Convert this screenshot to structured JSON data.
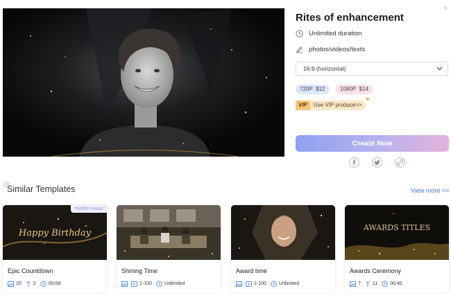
{
  "template": {
    "title": "Rites of enhancement",
    "duration": "Unlimited duration",
    "media": "photos/videos/texts",
    "ratio_selected": "16:9 (horizontal)"
  },
  "pricing": [
    {
      "label": "720P",
      "price": "$12"
    },
    {
      "label": "1080P",
      "price": "$14"
    }
  ],
  "vip": {
    "badge": "VIP",
    "text": "Use VIP produce>>"
  },
  "actions": {
    "create": "Create Now"
  },
  "share_icons": [
    "facebook-icon",
    "twitter-icon",
    "link-icon"
  ],
  "similar": {
    "heading": "Similar Templates",
    "view_more": "View more >>",
    "cards": [
      {
        "title": "Epic Countdown",
        "badge": "rhythm music",
        "photos": "20",
        "texts": "2",
        "time": "00:58",
        "thumb_text": "Happy Birthday"
      },
      {
        "title": "Shining Time",
        "media": "1-100",
        "time": "Unlimited"
      },
      {
        "title": "Award time",
        "media": "1-100",
        "time": "Unlimited"
      },
      {
        "title": "Awards Ceremony",
        "photos": "7",
        "texts": "11",
        "time": "00:40",
        "thumb_text": "AWARDS TITLES"
      }
    ]
  },
  "colors": {
    "accent": "#3f7be0",
    "button_start": "#8ea1f2",
    "button_end": "#e5b2dc"
  }
}
